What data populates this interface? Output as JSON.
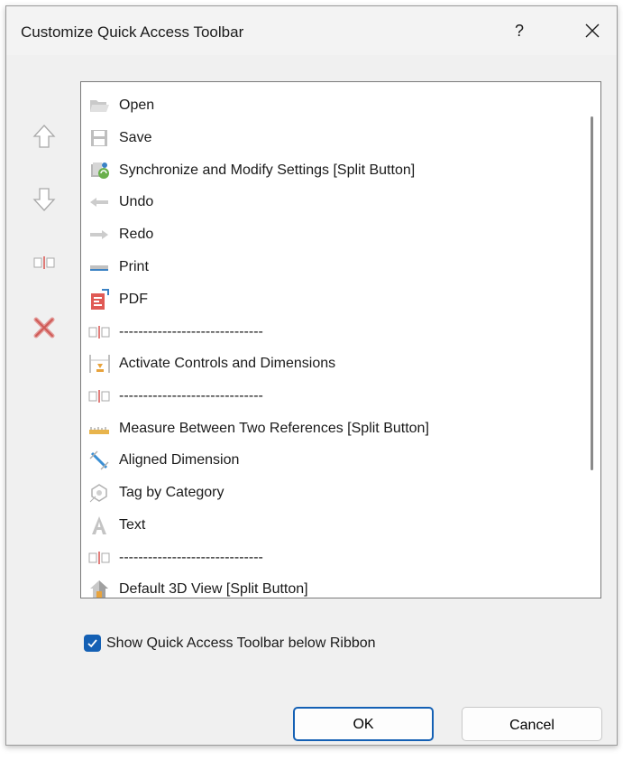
{
  "window": {
    "title": "Customize Quick Access Toolbar",
    "help_label": "?"
  },
  "list": {
    "items": [
      {
        "label": "Open",
        "icon": "open-folder-icon"
      },
      {
        "label": "Save",
        "icon": "save-icon"
      },
      {
        "label": "Synchronize and Modify Settings [Split Button]",
        "icon": "synchronize-icon"
      },
      {
        "label": "Undo",
        "icon": "undo-icon"
      },
      {
        "label": "Redo",
        "icon": "redo-icon"
      },
      {
        "label": "Print",
        "icon": "print-icon"
      },
      {
        "label": "PDF",
        "icon": "pdf-icon"
      },
      {
        "label": "------------------------------",
        "icon": "separator-icon"
      },
      {
        "label": "Activate Controls and Dimensions",
        "icon": "activate-controls-icon"
      },
      {
        "label": "------------------------------",
        "icon": "separator-icon"
      },
      {
        "label": "Measure Between Two References [Split Button]",
        "icon": "measure-icon"
      },
      {
        "label": "Aligned Dimension",
        "icon": "aligned-dimension-icon"
      },
      {
        "label": "Tag by Category",
        "icon": "tag-icon"
      },
      {
        "label": "Text",
        "icon": "text-icon"
      },
      {
        "label": "------------------------------",
        "icon": "separator-icon"
      },
      {
        "label": "Default 3D View [Split Button]",
        "icon": "house-3d-icon"
      }
    ]
  },
  "options": {
    "show_below_ribbon_label": "Show Quick Access Toolbar below Ribbon",
    "show_below_ribbon_checked": true
  },
  "buttons": {
    "ok_label": "OK",
    "cancel_label": "Cancel"
  },
  "colors": {
    "accent": "#1460b4",
    "delete_red": "#d9534f"
  }
}
